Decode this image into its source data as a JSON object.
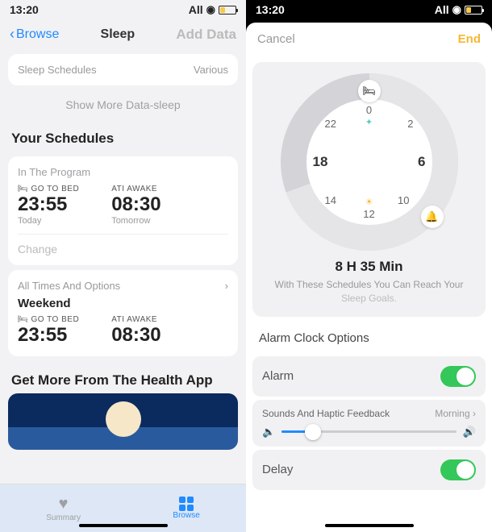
{
  "left": {
    "status_time": "13:20",
    "status_net": "All",
    "back": "Browse",
    "title": "Sleep",
    "add": "Add Data",
    "sched_label": "Sleep Schedules",
    "sched_value": "Various",
    "show_more": "Show More Data-sleep",
    "your_schedules": "Your Schedules",
    "in_program": "In The Program",
    "bed_label": "🛏 GO TO BED",
    "wake_label": "ATI AWAKE",
    "bed_time": "23:55",
    "wake_time": "08:30",
    "today": "Today",
    "tomorrow": "Tomorrow",
    "change": "Change",
    "all_times": "All Times And Options",
    "weekend": "Weekend",
    "get_more": "Get More From The Health App",
    "tab_summary": "Summary",
    "tab_browse": "Browse"
  },
  "right": {
    "status_time": "13:20",
    "status_net": "All",
    "cancel": "Cancel",
    "end": "End",
    "dial": {
      "n0": "0",
      "n2": "2",
      "n6": "6",
      "n10": "10",
      "n12": "12",
      "n14": "14",
      "n18": "18",
      "n22": "22"
    },
    "duration": "8 H 35 Min",
    "desc1": "With These Schedules You Can Reach Your",
    "desc2": "Sleep Goals.",
    "options_head": "Alarm Clock Options",
    "alarm": "Alarm",
    "sounds": "Sounds And Haptic Feedback",
    "morning": "Morning",
    "delay": "Delay"
  }
}
